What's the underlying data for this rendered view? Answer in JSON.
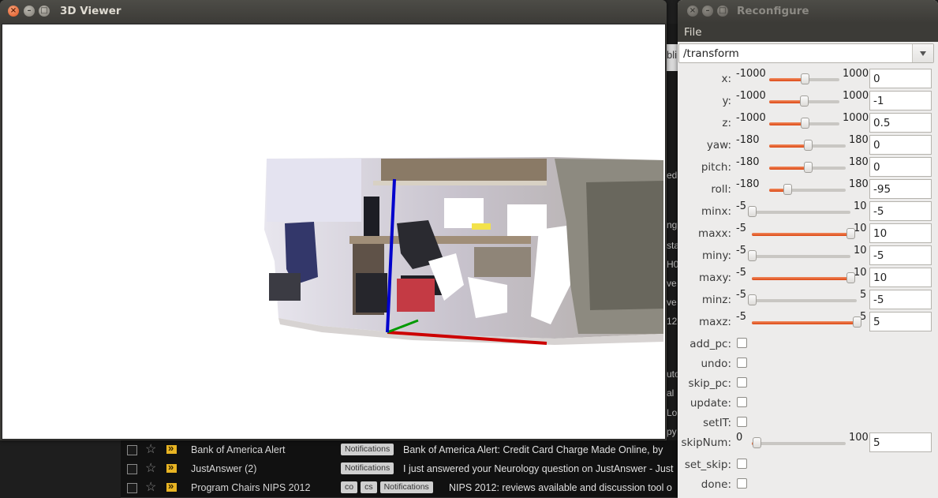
{
  "viewer": {
    "title": "3D Viewer"
  },
  "reconfigure": {
    "title": "Reconfigure",
    "menu": {
      "file": "File"
    },
    "node": "/transform",
    "params": [
      {
        "name": "x:",
        "min": "-1000",
        "max": "1000",
        "value": "0",
        "fraction": 0.5,
        "type": "slider"
      },
      {
        "name": "y:",
        "min": "-1000",
        "max": "1000",
        "value": "-1",
        "fraction": 0.4995,
        "type": "slider"
      },
      {
        "name": "z:",
        "min": "-1000",
        "max": "1000",
        "value": "0.5",
        "fraction": 0.50025,
        "type": "slider"
      },
      {
        "name": "yaw:",
        "min": "-180",
        "max": "180",
        "value": "0",
        "fraction": 0.5,
        "type": "slider"
      },
      {
        "name": "pitch:",
        "min": "-180",
        "max": "180",
        "value": "0",
        "fraction": 0.5,
        "type": "slider"
      },
      {
        "name": "roll:",
        "min": "-180",
        "max": "180",
        "value": "-95",
        "fraction": 0.2361,
        "type": "slider"
      },
      {
        "name": "minx:",
        "min": "-5",
        "max": "10",
        "value": "-5",
        "fraction": 0,
        "type": "slider"
      },
      {
        "name": "maxx:",
        "min": "-5",
        "max": "10",
        "value": "10",
        "fraction": 1,
        "type": "slider"
      },
      {
        "name": "miny:",
        "min": "-5",
        "max": "10",
        "value": "-5",
        "fraction": 0,
        "type": "slider"
      },
      {
        "name": "maxy:",
        "min": "-5",
        "max": "10",
        "value": "10",
        "fraction": 1,
        "type": "slider"
      },
      {
        "name": "minz:",
        "min": "-5",
        "max": "5",
        "value": "-5",
        "fraction": 0,
        "type": "slider"
      },
      {
        "name": "maxz:",
        "min": "-5",
        "max": "5",
        "value": "5",
        "fraction": 1,
        "type": "slider"
      },
      {
        "name": "add_pc:",
        "type": "checkbox",
        "checked": false
      },
      {
        "name": "undo:",
        "type": "checkbox",
        "checked": false
      },
      {
        "name": "skip_pc:",
        "type": "checkbox",
        "checked": false
      },
      {
        "name": "update:",
        "type": "checkbox",
        "checked": false
      },
      {
        "name": "setIT:",
        "type": "checkbox",
        "checked": false
      },
      {
        "name": "skipNum:",
        "min": "0",
        "max": "100",
        "value": "5",
        "fraction": 0.05,
        "type": "slider"
      },
      {
        "name": "set_skip:",
        "type": "checkbox",
        "checked": false
      },
      {
        "name": "done:",
        "type": "checkbox",
        "checked": false
      }
    ]
  },
  "email": {
    "rows": [
      {
        "sender": "Bank of America Alert",
        "labels": [
          "Notifications"
        ],
        "subject": "Bank of America Alert: Credit Card Charge Made Online, by"
      },
      {
        "sender": "JustAnswer (2)",
        "labels": [
          "Notifications"
        ],
        "subject": "I just answered your Neurology question on JustAnswer - Just"
      },
      {
        "sender": "Program Chairs NIPS 2012",
        "labels": [
          "co",
          "cs",
          "Notifications"
        ],
        "subject": "NIPS 2012: reviews available and discussion tool o"
      }
    ],
    "fragments": [
      "bli",
      "ed",
      "ng",
      "sta",
      "H0",
      "ve",
      "ve",
      "12",
      "uto",
      "al",
      "Lo",
      "py"
    ]
  },
  "colors": {
    "accent": "#dd4814",
    "axis_x": "#cc0000",
    "axis_y": "#009900",
    "axis_z": "#0000cc",
    "titlebar": "#3c3b37"
  }
}
